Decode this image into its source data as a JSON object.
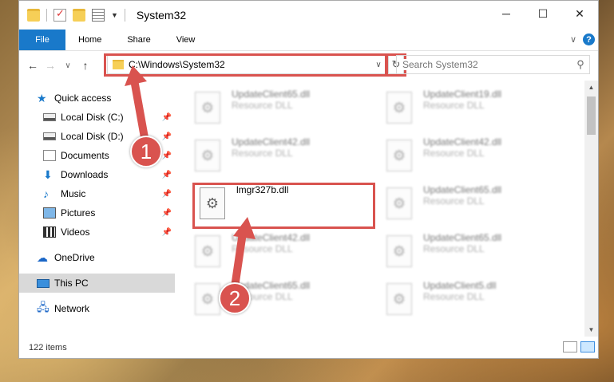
{
  "window": {
    "title": "System32",
    "controls": {
      "minimize": "─",
      "maximize": "☐",
      "close": "✕"
    }
  },
  "ribbon": {
    "tabs": [
      "File",
      "Home",
      "Share",
      "View"
    ],
    "expand": "∨",
    "help": "?"
  },
  "nav": {
    "back": "←",
    "forward": "→",
    "recent": "∨",
    "up": "↑",
    "address": "C:\\Windows\\System32",
    "address_drop": "∨",
    "refresh": "↻",
    "search_placeholder": "Search System32",
    "search_icon": "search-icon"
  },
  "sidebar": {
    "quick_access": "Quick access",
    "items": [
      {
        "label": "Local Disk (C:)",
        "icon": "drive-icon"
      },
      {
        "label": "Local Disk (D:)",
        "icon": "drive-icon"
      },
      {
        "label": "Documents",
        "icon": "documents-icon"
      },
      {
        "label": "Downloads",
        "icon": "downloads-icon"
      },
      {
        "label": "Music",
        "icon": "music-icon"
      },
      {
        "label": "Pictures",
        "icon": "pictures-icon"
      },
      {
        "label": "Videos",
        "icon": "videos-icon"
      }
    ],
    "onedrive": "OneDrive",
    "this_pc": "This PC",
    "network": "Network"
  },
  "files": [
    {
      "name": "UpdateClient65.dll",
      "type": "Resource DLL"
    },
    {
      "name": "UpdateClient19.dll",
      "type": "Resource DLL"
    },
    {
      "name": "UpdateClient42.dll",
      "type": "Resource DLL"
    },
    {
      "name": "UpdateClient42.dll",
      "type": "Resource DLL"
    },
    {
      "name": "lmgr327b.dll",
      "type": ""
    },
    {
      "name": "UpdateClient65.dll",
      "type": "Resource DLL"
    },
    {
      "name": "UpdateClient42.dll",
      "type": "Resource DLL"
    },
    {
      "name": "UpdateClient65.dll",
      "type": "Resource DLL"
    },
    {
      "name": "UpdateClient65.dll",
      "type": "Resource DLL"
    },
    {
      "name": "UpdateClient5.dll",
      "type": "Resource DLL"
    }
  ],
  "status": {
    "item_count": "122 items"
  },
  "annotations": {
    "badge1": "1",
    "badge2": "2",
    "highlight_color": "#d9534f"
  }
}
